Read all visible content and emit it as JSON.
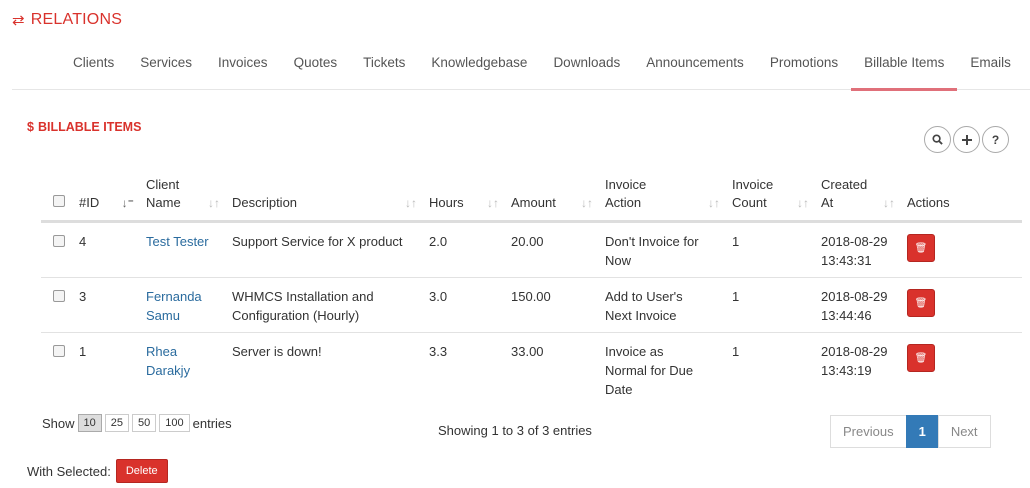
{
  "header": {
    "icon": "⇄",
    "title": "RELATIONS"
  },
  "tabs": [
    {
      "label": "Clients"
    },
    {
      "label": "Services"
    },
    {
      "label": "Invoices"
    },
    {
      "label": "Quotes"
    },
    {
      "label": "Tickets"
    },
    {
      "label": "Knowledgebase"
    },
    {
      "label": "Downloads"
    },
    {
      "label": "Announcements"
    },
    {
      "label": "Promotions"
    },
    {
      "label": "Billable Items"
    },
    {
      "label": "Emails"
    }
  ],
  "active_tab": "Billable Items",
  "panel": {
    "icon": "$",
    "title": "BILLABLE ITEMS"
  },
  "table": {
    "headers": {
      "id": "#ID",
      "client_1": "Client",
      "client_2": "Name",
      "description": "Description",
      "hours": "Hours",
      "amount": "Amount",
      "inv_action_1": "Invoice",
      "inv_action_2": "Action",
      "inv_count_1": "Invoice",
      "inv_count_2": "Count",
      "created_1": "Created",
      "created_2": "At",
      "actions": "Actions"
    },
    "rows": [
      {
        "id": "4",
        "client_1": "Test Tester",
        "client_2": "",
        "desc_1": "Support Service for X product",
        "desc_2": "",
        "hours": "2.0",
        "amount": "20.00",
        "act_1": "Don't Invoice for",
        "act_2": "Now",
        "act_3": "",
        "count": "1",
        "date": "2018-08-29",
        "time": "13:43:31"
      },
      {
        "id": "3",
        "client_1": "Fernanda",
        "client_2": "Samu",
        "desc_1": "WHMCS Installation and",
        "desc_2": "Configuration (Hourly)",
        "hours": "3.0",
        "amount": "150.00",
        "act_1": "Add to User's",
        "act_2": "Next Invoice",
        "act_3": "",
        "count": "1",
        "date": "2018-08-29",
        "time": "13:44:46"
      },
      {
        "id": "1",
        "client_1": "Rhea",
        "client_2": "Darakjy",
        "desc_1": "Server is down!",
        "desc_2": "",
        "hours": "3.3",
        "amount": "33.00",
        "act_1": "Invoice as",
        "act_2": "Normal for Due",
        "act_3": "Date",
        "count": "1",
        "date": "2018-08-29",
        "time": "13:43:19"
      }
    ]
  },
  "length_menu": {
    "show": "Show",
    "options": [
      "10",
      "25",
      "50",
      "100"
    ],
    "selected": "10",
    "entries": "entries"
  },
  "info": "Showing 1 to 3 of 3 entries",
  "pagination": {
    "previous": "Previous",
    "current": "1",
    "next": "Next"
  },
  "with_selected": {
    "label": "With Selected:",
    "button": "Delete"
  },
  "colors": {
    "accent": "#d9322c",
    "link": "#2a6b9e",
    "primary": "#337ab7",
    "tab_underline": "#e0707a"
  }
}
